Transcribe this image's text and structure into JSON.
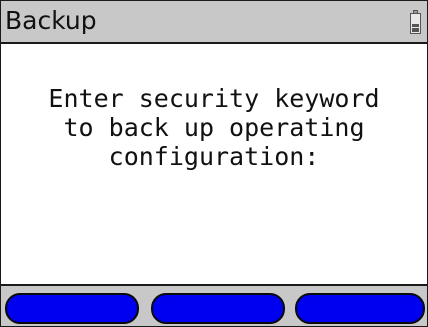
{
  "header": {
    "title": "Backup",
    "status_icon": "battery-icon"
  },
  "main": {
    "message_lines": [
      "Enter security keyword",
      "to back up operating",
      "configuration:"
    ]
  },
  "softkeys": {
    "left_label": "",
    "middle_label": "",
    "right_label": "",
    "color": "#0000f0"
  },
  "colors": {
    "title_bar": "#c8c8c8",
    "background": "#ffffff",
    "border": "#1a1a1a"
  }
}
